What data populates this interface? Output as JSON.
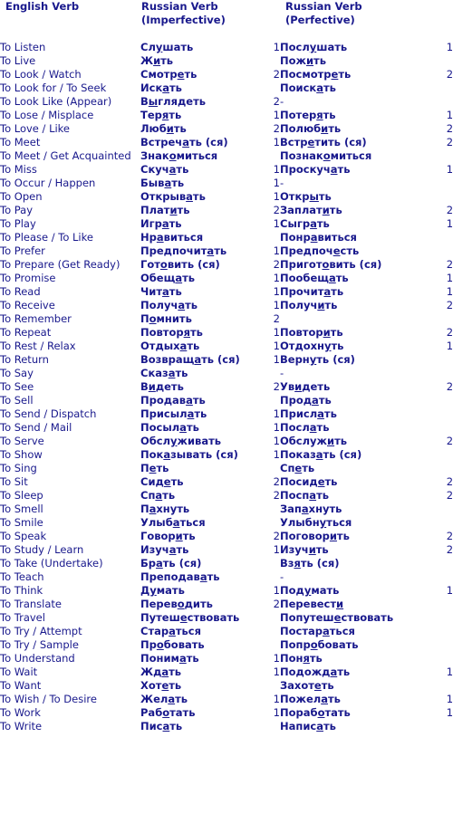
{
  "headers": {
    "english": "English Verb",
    "imperfective_line1": "Russian Verb",
    "imperfective_line2": "(Imperfective)",
    "perfective_line1": "Russian Verb",
    "perfective_line2": "(Perfective)",
    "num_imperfective": "",
    "num_perfective": ""
  },
  "colors": {
    "text": "#18188c",
    "background": "#ffffff"
  },
  "rows": [
    {
      "english": "To Listen",
      "imperfective": "Сл<u>у</u>шать",
      "num1": "1",
      "perfective": "Посл<u>у</u>шать",
      "num2": "1"
    },
    {
      "english": "To Live",
      "imperfective": "Ж<u>и</u>ть",
      "num1": "",
      "perfective": "Пож<u>и</u>ть",
      "num2": ""
    },
    {
      "english": "To Look / Watch",
      "imperfective": "Смотр<u>е</u>ть",
      "num1": "2",
      "perfective": "Посмотр<u>е</u>ть",
      "num2": "2"
    },
    {
      "english": "To Look for / To Seek",
      "imperfective": "Иск<u>а</u>ть",
      "num1": "",
      "perfective": "Поиск<u>а</u>ть",
      "num2": ""
    },
    {
      "english": "To Look Like (Appear)",
      "imperfective": "В<u>ы</u>глядеть",
      "num1": "2",
      "perfective": "-",
      "num2": ""
    },
    {
      "english": "To Lose / Misplace",
      "imperfective": "Тер<u>я</u>ть",
      "num1": "1",
      "perfective": "Потер<u>я</u>ть",
      "num2": "1"
    },
    {
      "english": "To Love / Like",
      "imperfective": "Люб<u>и</u>ть",
      "num1": "2",
      "perfective": "Полюб<u>и</u>ть",
      "num2": "2"
    },
    {
      "english": "To Meet",
      "imperfective": "Встреч<u>а</u>ть (ся)",
      "num1": "1",
      "perfective": "Встр<u>е</u>тить (ся)",
      "num2": "2"
    },
    {
      "english": "To Meet / Get Acquainted",
      "imperfective": "Знак<u>о</u>миться",
      "num1": "",
      "perfective": "Познак<u>о</u>миться",
      "num2": ""
    },
    {
      "english": "To Miss",
      "imperfective": "Скуч<u>а</u>ть",
      "num1": "1",
      "perfective": "Проскуч<u>а</u>ть",
      "num2": "1"
    },
    {
      "english": "To Occur / Happen",
      "imperfective": "Быв<u>а</u>ть",
      "num1": "1",
      "perfective": "-",
      "num2": ""
    },
    {
      "english": "To Open",
      "imperfective": "Открыв<u>а</u>ть",
      "num1": "1",
      "perfective": "Откр<u>ы</u>ть",
      "num2": ""
    },
    {
      "english": "To Pay",
      "imperfective": "Плат<u>и</u>ть",
      "num1": "2",
      "perfective": "Заплат<u>и</u>ть",
      "num2": "2"
    },
    {
      "english": "To Play",
      "imperfective": "Игр<u>а</u>ть",
      "num1": "1",
      "perfective": "Сыгр<u>а</u>ть",
      "num2": "1"
    },
    {
      "english": "To Please / To Like",
      "imperfective": "Нр<u>а</u>виться",
      "num1": "",
      "perfective": "Понр<u>а</u>виться",
      "num2": ""
    },
    {
      "english": "To Prefer",
      "imperfective": "Предпочит<u>а</u>ть",
      "num1": "1",
      "perfective": "Предпоч<u>е</u>сть",
      "num2": ""
    },
    {
      "english": "To Prepare (Get Ready)",
      "imperfective": "Гот<u>о</u>вить (ся)",
      "num1": "2",
      "perfective": "Пригот<u>о</u>вить (ся)",
      "num2": "2"
    },
    {
      "english": "To Promise",
      "imperfective": "Обещ<u>а</u>ть",
      "num1": "1",
      "perfective": "Пообещ<u>а</u>ть",
      "num2": "1"
    },
    {
      "english": "To Read",
      "imperfective": "Чит<u>а</u>ть",
      "num1": "1",
      "perfective": "Прочит<u>а</u>ть",
      "num2": "1"
    },
    {
      "english": "To Receive",
      "imperfective": "Получ<u>а</u>ть",
      "num1": "1",
      "perfective": "Получ<u>и</u>ть",
      "num2": "2"
    },
    {
      "english": "To Remember",
      "imperfective": "П<u>о</u>мнить",
      "num1": "2",
      "perfective": "",
      "num2": ""
    },
    {
      "english": "To Repeat",
      "imperfective": "Повтор<u>я</u>ть",
      "num1": "1",
      "perfective": "Повтор<u>и</u>ть",
      "num2": "2"
    },
    {
      "english": "To Rest / Relax",
      "imperfective": "Отдых<u>а</u>ть",
      "num1": "1",
      "perfective": "Отдохн<u>у</u>ть",
      "num2": "1"
    },
    {
      "english": "To Return",
      "imperfective": "Возвращ<u>а</u>ть (ся)",
      "num1": "1",
      "perfective": "Верн<u>у</u>ть (ся)",
      "num2": ""
    },
    {
      "english": "To Say",
      "imperfective": "Сказ<u>а</u>ть",
      "num1": "",
      "perfective": "-",
      "num2": ""
    },
    {
      "english": "To See",
      "imperfective": "В<u>и</u>деть",
      "num1": "2",
      "perfective": "Ув<u>и</u>деть",
      "num2": "2"
    },
    {
      "english": "To Sell",
      "imperfective": "Продав<u>а</u>ть",
      "num1": "",
      "perfective": "Прод<u>а</u>ть",
      "num2": ""
    },
    {
      "english": "To Send / Dispatch",
      "imperfective": "Присыл<u>а</u>ть",
      "num1": "1",
      "perfective": "Присл<u>а</u>ть",
      "num2": ""
    },
    {
      "english": "To Send / Mail",
      "imperfective": "Посыл<u>а</u>ть",
      "num1": "1",
      "perfective": "Посл<u>а</u>ть",
      "num2": ""
    },
    {
      "english": "To Serve",
      "imperfective": "Обсл<u>у</u>живать",
      "num1": "1",
      "perfective": "Обслуж<u>и</u>ть",
      "num2": "2"
    },
    {
      "english": "To Show",
      "imperfective": "Пок<u>а</u>зывать (ся)",
      "num1": "1",
      "perfective": "Показ<u>а</u>ть (ся)",
      "num2": ""
    },
    {
      "english": "To Sing",
      "imperfective": "П<u>е</u>ть",
      "num1": "",
      "perfective": "Сп<u>е</u>ть",
      "num2": ""
    },
    {
      "english": "To Sit",
      "imperfective": "Сид<u>е</u>ть",
      "num1": "2",
      "perfective": "Посид<u>е</u>ть",
      "num2": "2"
    },
    {
      "english": "To Sleep",
      "imperfective": "Сп<u>а</u>ть",
      "num1": "2",
      "perfective": "Посп<u>а</u>ть",
      "num2": "2"
    },
    {
      "english": "To Smell",
      "imperfective": "П<u>а</u>хнуть",
      "num1": "",
      "perfective": "Зап<u>а</u>хнуть",
      "num2": ""
    },
    {
      "english": "To Smile",
      "imperfective": "Улыб<u>а</u>ться",
      "num1": "",
      "perfective": "Улыбн<u>у</u>ться",
      "num2": ""
    },
    {
      "english": "To Speak",
      "imperfective": "Говор<u>и</u>ть",
      "num1": "2",
      "perfective": "Поговор<u>и</u>ть",
      "num2": "2"
    },
    {
      "english": "To Study / Learn",
      "imperfective": "Изуч<u>а</u>ть",
      "num1": "1",
      "perfective": "Изуч<u>и</u>ть",
      "num2": "2"
    },
    {
      "english": "To Take (Undertake)",
      "imperfective": "Бр<u>а</u>ть (ся)",
      "num1": "",
      "perfective": "Вз<u>я</u>ть (ся)",
      "num2": ""
    },
    {
      "english": "To Teach",
      "imperfective": "Преподав<u>а</u>ть",
      "num1": "",
      "perfective": "-",
      "num2": ""
    },
    {
      "english": "To Think",
      "imperfective": "Д<u>у</u>мать",
      "num1": "1",
      "perfective": "Под<u>у</u>мать",
      "num2": "1"
    },
    {
      "english": "To Translate",
      "imperfective": "Перев<u>о</u>дить",
      "num1": "2",
      "perfective": "Перевест<u>и</u>",
      "num2": ""
    },
    {
      "english": "To Travel",
      "imperfective": "Путеш<u>е</u>ствовать",
      "num1": "",
      "perfective": "Попутеш<u>е</u>ствовать",
      "num2": ""
    },
    {
      "english": "To Try / Attempt",
      "imperfective": "Стар<u>а</u>ться",
      "num1": "",
      "perfective": "Постар<u>а</u>ться",
      "num2": ""
    },
    {
      "english": "To Try / Sample",
      "imperfective": "Пр<u>о</u>бовать",
      "num1": "",
      "perfective": "Попр<u>о</u>бовать",
      "num2": ""
    },
    {
      "english": "To Understand",
      "imperfective": "Поним<u>а</u>ть",
      "num1": "1",
      "perfective": "Пон<u>я</u>ть",
      "num2": ""
    },
    {
      "english": "To Wait",
      "imperfective": "Жд<u>а</u>ть",
      "num1": "1",
      "perfective": "Подожд<u>а</u>ть",
      "num2": "1"
    },
    {
      "english": "To Want",
      "imperfective": "Хот<u>е</u>ть",
      "num1": "",
      "perfective": "Захот<u>е</u>ть",
      "num2": ""
    },
    {
      "english": "To Wish / To Desire",
      "imperfective": "Жел<u>а</u>ть",
      "num1": "1",
      "perfective": "Пожел<u>а</u>ть",
      "num2": "1"
    },
    {
      "english": "To Work",
      "imperfective": "Раб<u>о</u>тать",
      "num1": "1",
      "perfective": "Пораб<u>о</u>тать",
      "num2": "1"
    },
    {
      "english": "To Write",
      "imperfective": "Пис<u>а</u>ть",
      "num1": "",
      "perfective": "Напис<u>а</u>ть",
      "num2": ""
    }
  ]
}
